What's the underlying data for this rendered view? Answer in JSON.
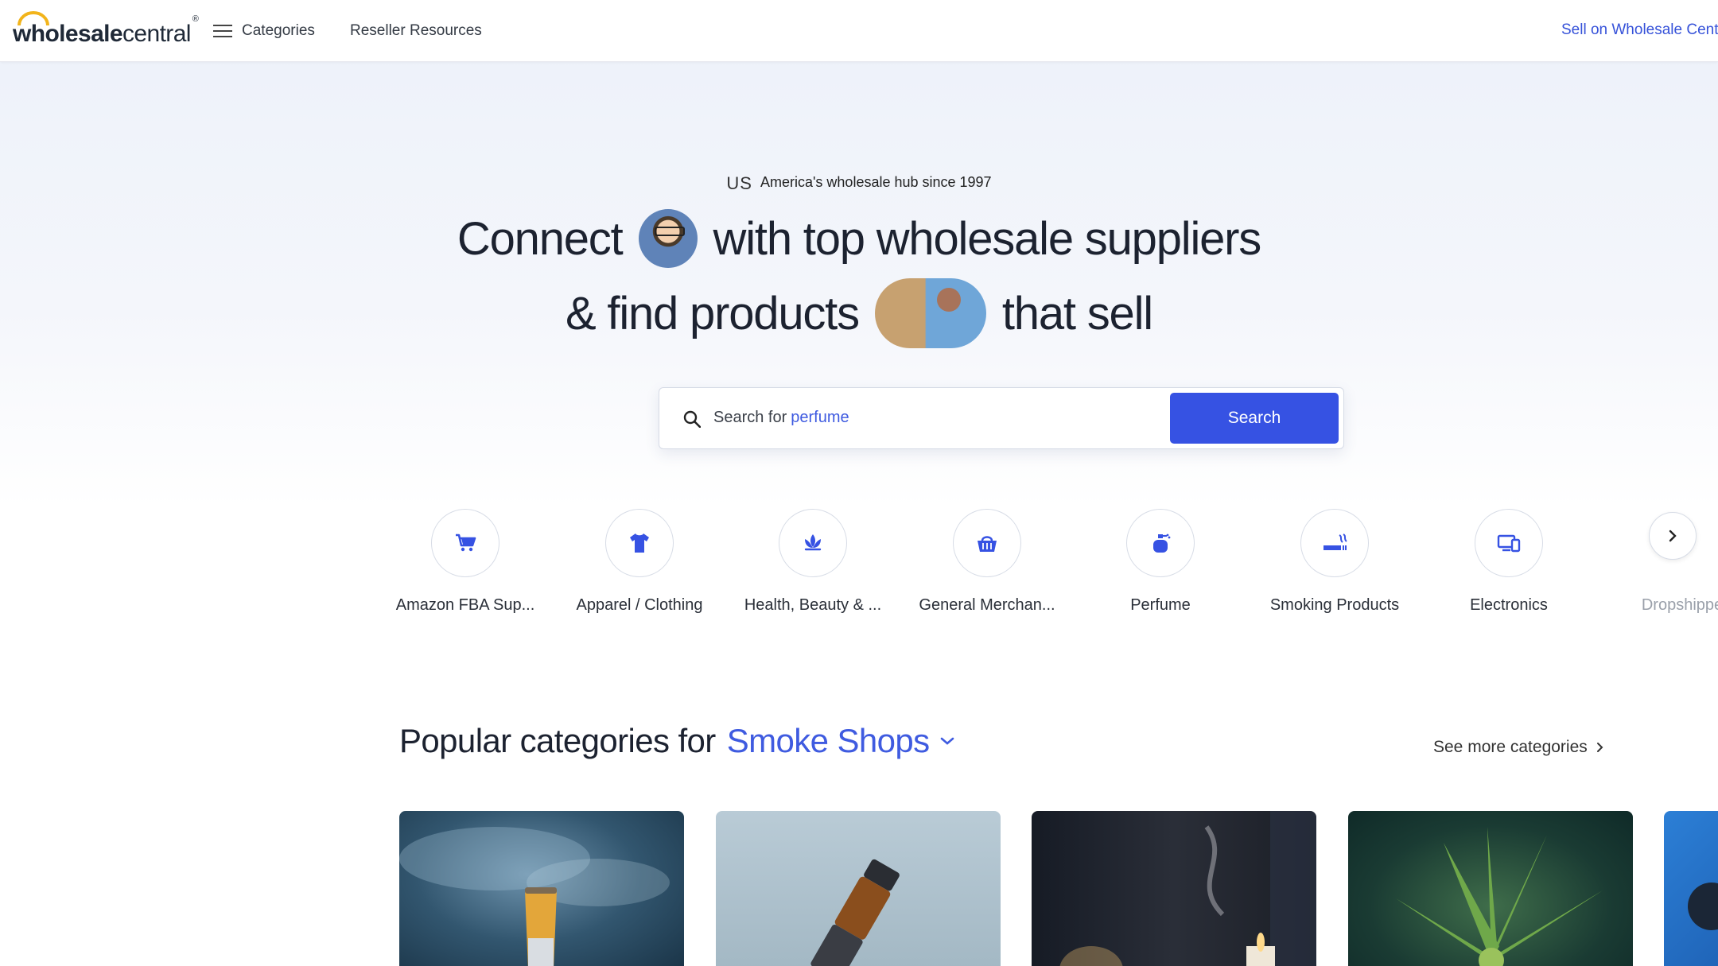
{
  "header": {
    "logo_bold": "wholesale",
    "logo_light": "central",
    "logo_reg": "®",
    "nav_categories": "Categories",
    "nav_resources": "Reseller Resources",
    "sell_link": "Sell on Wholesale Cent"
  },
  "hero": {
    "country": "US",
    "tagline": "America's wholesale hub since 1997",
    "line1_a": "Connect",
    "line1_b": "with top wholesale suppliers",
    "line2_a": "& find products",
    "line2_b": "that sell"
  },
  "search": {
    "placeholder_prefix": "Search for",
    "placeholder_hint": "perfume",
    "button_label": "Search"
  },
  "categories": [
    {
      "label": "Amazon FBA Sup...",
      "icon": "cart-icon"
    },
    {
      "label": "Apparel / Clothing",
      "icon": "shirt-icon"
    },
    {
      "label": "Health, Beauty & ...",
      "icon": "lotus-icon"
    },
    {
      "label": "General Merchan...",
      "icon": "basket-icon"
    },
    {
      "label": "Perfume",
      "icon": "perfume-icon"
    },
    {
      "label": "Smoking Products",
      "icon": "cigarette-icon"
    },
    {
      "label": "Electronics",
      "icon": "devices-icon"
    },
    {
      "label": "Dropshippe",
      "icon": "none"
    }
  ],
  "popular": {
    "title_prefix": "Popular categories for",
    "selected": "Smoke Shops",
    "see_more": "See more categories"
  },
  "colors": {
    "accent": "#3652e3",
    "link": "#3f5be0",
    "logo_arc": "#f2b41b"
  }
}
